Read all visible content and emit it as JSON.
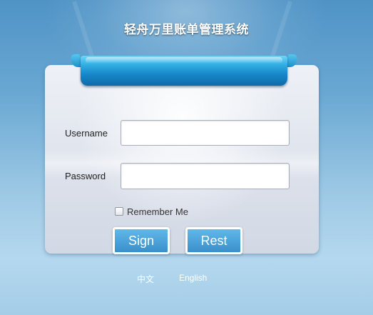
{
  "app": {
    "title": "轻舟万里账单管理系统"
  },
  "login": {
    "username_label": "Username",
    "username_value": "",
    "password_label": "Password",
    "password_value": "",
    "remember_label": "Remember Me",
    "remember_checked": false,
    "sign_label": "Sign",
    "reset_label": "Rest"
  },
  "languages": [
    {
      "label": "中文"
    },
    {
      "label": "English"
    }
  ],
  "colors": {
    "background_top": "#4f93c6",
    "background_bottom": "#b4d8ee",
    "ribbon": "#1787c9",
    "button": "#4aa2d9",
    "card": "#e4e8ef"
  }
}
